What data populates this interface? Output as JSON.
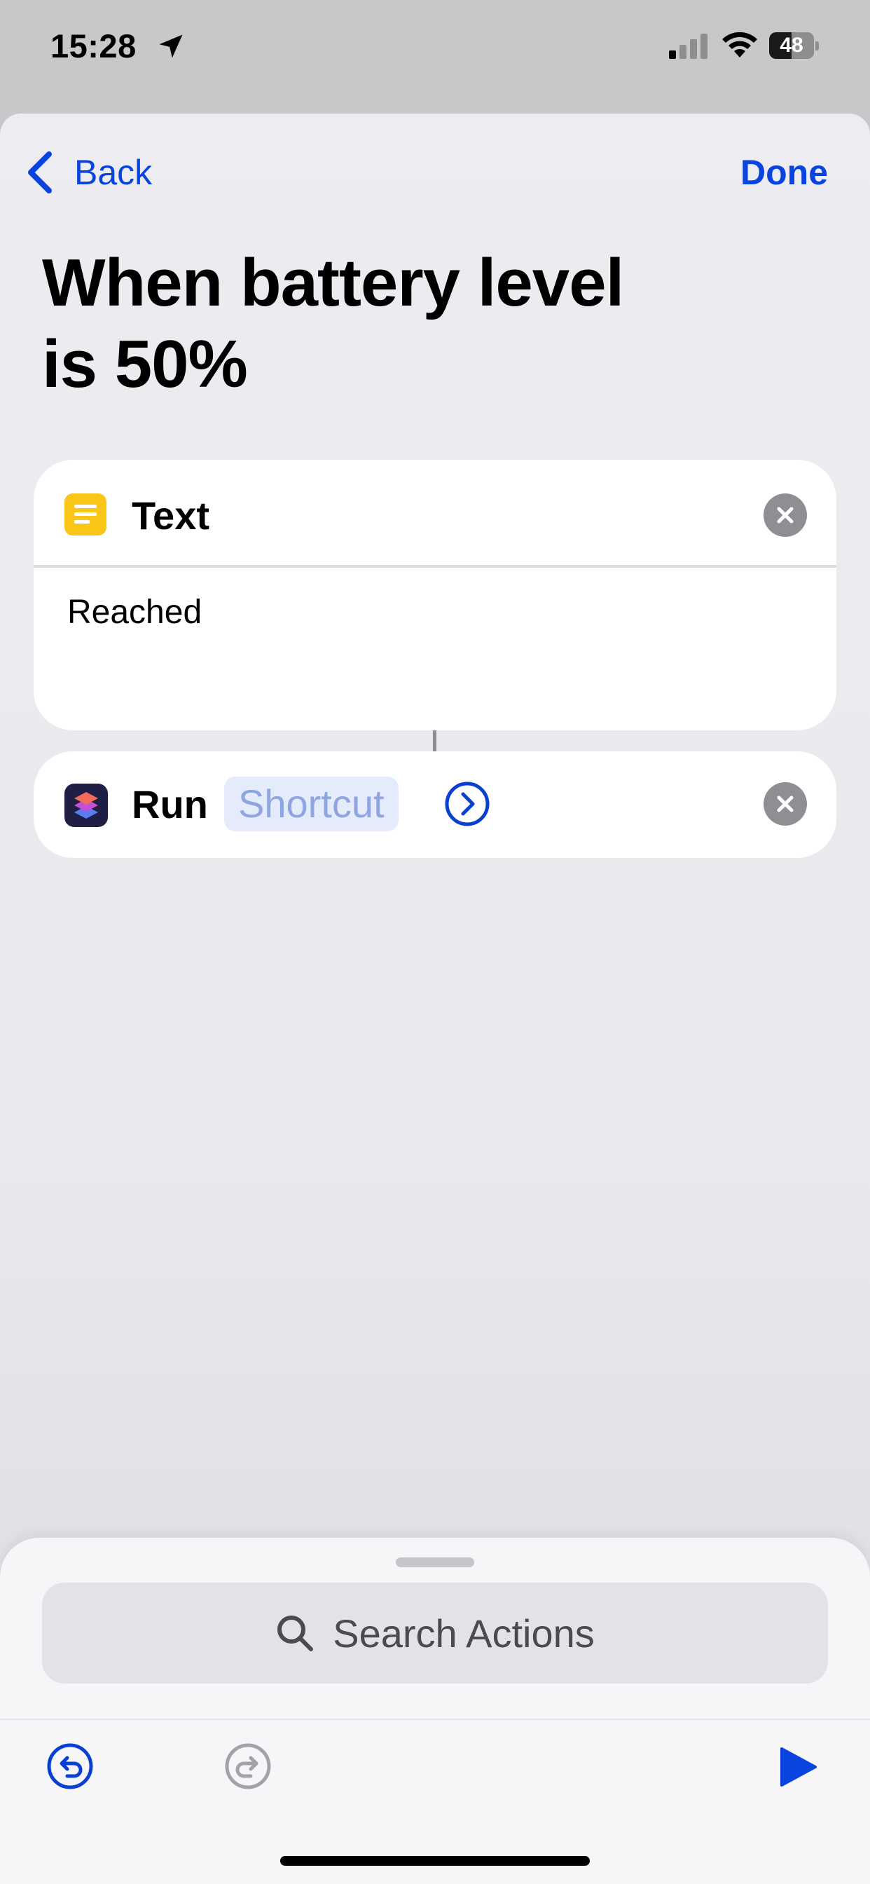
{
  "status_bar": {
    "time": "15:28",
    "battery_level": "48",
    "location_icon": "location-arrow-icon",
    "signal_icon": "cellular-signal-icon",
    "wifi_icon": "wifi-icon"
  },
  "nav": {
    "back_label": "Back",
    "done_label": "Done",
    "accent_color": "#0a44e0"
  },
  "page": {
    "title_line1": "When battery level",
    "title_line2": "is 50%"
  },
  "actions": [
    {
      "title": "Text",
      "icon": "text-lines-icon",
      "icon_color": "#f9c516",
      "content": "Reached"
    },
    {
      "label": "Run",
      "icon": "shortcuts-app-icon",
      "token": "Shortcut"
    }
  ],
  "bottom": {
    "search_placeholder": "Search Actions",
    "undo_icon": "undo-icon",
    "redo_icon": "redo-icon",
    "play_icon": "play-icon"
  }
}
